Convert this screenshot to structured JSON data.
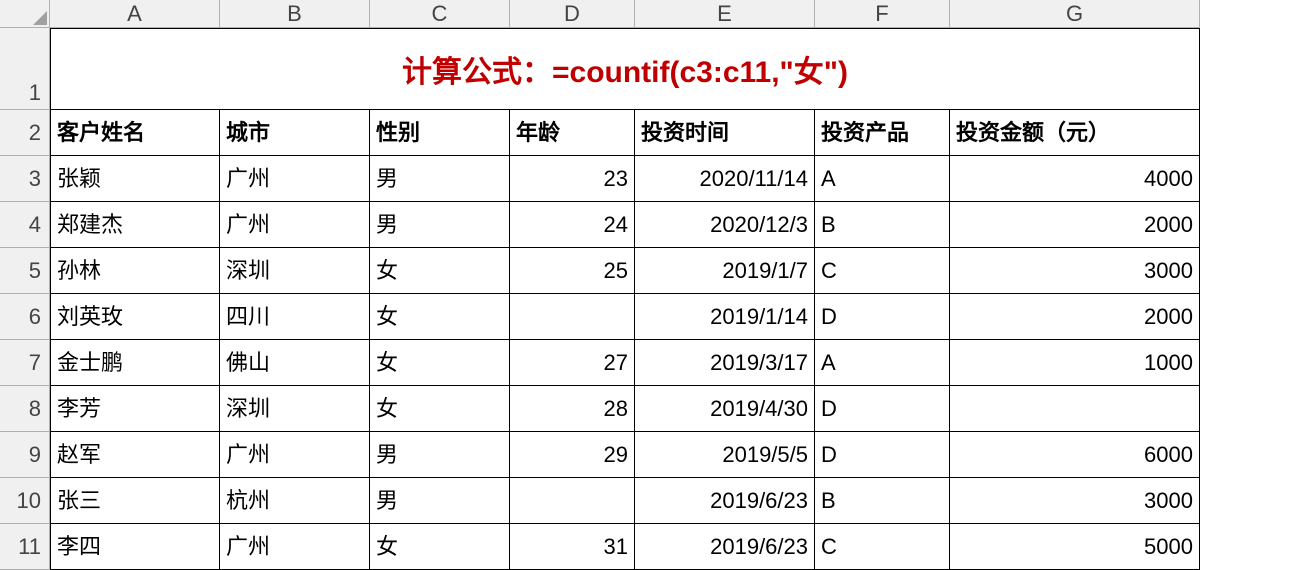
{
  "columns": [
    "A",
    "B",
    "C",
    "D",
    "E",
    "F",
    "G"
  ],
  "merged_title": "计算公式：=countif(c3:c11,\"女\")",
  "headers": [
    "客户姓名",
    "城市",
    "性别",
    "年龄",
    "投资时间",
    "投资产品",
    "投资金额（元）"
  ],
  "rows": [
    {
      "n": "3",
      "name": "张颖",
      "city": "广州",
      "gender": "男",
      "age": "23",
      "date": "2020/11/14",
      "product": "A",
      "amount": "4000"
    },
    {
      "n": "4",
      "name": "郑建杰",
      "city": "广州",
      "gender": "男",
      "age": "24",
      "date": "2020/12/3",
      "product": "B",
      "amount": "2000"
    },
    {
      "n": "5",
      "name": "孙林",
      "city": "深圳",
      "gender": "女",
      "age": "25",
      "date": "2019/1/7",
      "product": "C",
      "amount": "3000"
    },
    {
      "n": "6",
      "name": "刘英玫",
      "city": "四川",
      "gender": "女",
      "age": "",
      "date": "2019/1/14",
      "product": "D",
      "amount": "2000"
    },
    {
      "n": "7",
      "name": "金士鹏",
      "city": "佛山",
      "gender": "女",
      "age": "27",
      "date": "2019/3/17",
      "product": "A",
      "amount": "1000"
    },
    {
      "n": "8",
      "name": "李芳",
      "city": "深圳",
      "gender": "女",
      "age": "28",
      "date": "2019/4/30",
      "product": "D",
      "amount": ""
    },
    {
      "n": "9",
      "name": "赵军",
      "city": "广州",
      "gender": "男",
      "age": "29",
      "date": "2019/5/5",
      "product": "D",
      "amount": "6000"
    },
    {
      "n": "10",
      "name": "张三",
      "city": "杭州",
      "gender": "男",
      "age": "",
      "date": "2019/6/23",
      "product": "B",
      "amount": "3000"
    },
    {
      "n": "11",
      "name": "李四",
      "city": "广州",
      "gender": "女",
      "age": "31",
      "date": "2019/6/23",
      "product": "C",
      "amount": "5000"
    }
  ]
}
